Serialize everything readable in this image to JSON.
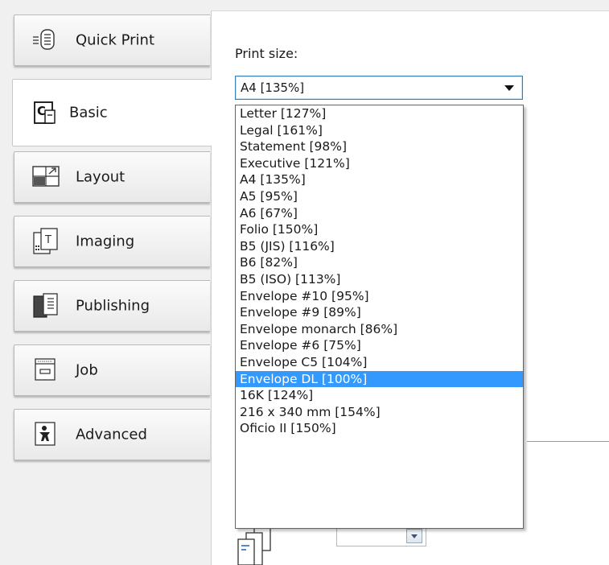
{
  "tabs": [
    {
      "label": "Quick Print",
      "icon": "quick-print-icon"
    },
    {
      "label": "Basic",
      "icon": "basic-icon"
    },
    {
      "label": "Layout",
      "icon": "layout-icon"
    },
    {
      "label": "Imaging",
      "icon": "imaging-icon"
    },
    {
      "label": "Publishing",
      "icon": "publishing-icon"
    },
    {
      "label": "Job",
      "icon": "job-icon"
    },
    {
      "label": "Advanced",
      "icon": "advanced-icon"
    }
  ],
  "active_tab": "Basic",
  "print_size": {
    "label": "Print size:",
    "selected": "A4  [135%]",
    "highlighted": "Envelope DL  [100%]",
    "options": [
      "Letter  [127%]",
      "Legal  [161%]",
      "Statement  [98%]",
      "Executive  [121%]",
      "A4  [135%]",
      "A5  [95%]",
      "A6  [67%]",
      "Folio  [150%]",
      "B5 (JIS)  [116%]",
      "B6  [82%]",
      "B5 (ISO)   [113%]",
      "Envelope #10  [95%]",
      "Envelope #9  [89%]",
      "Envelope monarch  [86%]",
      "Envelope #6  [75%]",
      "Envelope C5  [104%]",
      "Envelope DL  [100%]",
      "16K  [124%]",
      "216 x 340 mm  [154%]",
      "Oficio II  [150%]"
    ]
  },
  "colors": {
    "highlight": "#3399ff",
    "select_border": "#3c7fb1"
  }
}
